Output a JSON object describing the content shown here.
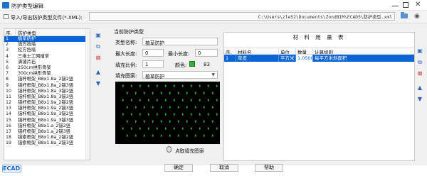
{
  "window": {
    "title": "防护类型编辑"
  },
  "import": {
    "label": "导入/导出防护类型文件(*.XML):",
    "path": "C:\\Users\\zle52\\Documents\\ZondBIM\\ECAD5\\防护类型.xml"
  },
  "type_list": {
    "col_index": "序.",
    "col_type": "防护类型",
    "items": [
      {
        "n": "1",
        "t": "植草防护"
      },
      {
        "n": "2",
        "t": "填方挡墙"
      },
      {
        "n": "3",
        "t": "挖方挡墙"
      },
      {
        "n": "4",
        "t": "三维土工网植草"
      },
      {
        "n": "5",
        "t": "满铺片石"
      },
      {
        "n": "6",
        "t": "250cm拱形骨架"
      },
      {
        "n": "7",
        "t": "300cm拱形骨架"
      },
      {
        "n": "8",
        "t": "锚杆框架_B8x1.8a_2锚2竖"
      },
      {
        "n": "9",
        "t": "锚杆框架_B8x1.8a_2锚3竖"
      },
      {
        "n": "10",
        "t": "锚杆框架_B8x1.8a_3锚2竖"
      },
      {
        "n": "11",
        "t": "锚杆框架_B8x1.8a_3锚3竖"
      },
      {
        "n": "12",
        "t": "锚杆框架_B8x1.9a_2锚2竖"
      },
      {
        "n": "13",
        "t": "锚杆框架_B8x1.9a_2锚3竖"
      },
      {
        "n": "14",
        "t": "锚杆框架_B8x1.9a_3锚2竖"
      },
      {
        "n": "15",
        "t": "锚杆框架_B8x1.9a_3锚3竖"
      },
      {
        "n": "16",
        "t": "锚杆框架_B8x1.a_2锚2竖"
      },
      {
        "n": "17",
        "t": "锚杆框架_B8x1.a_2锚3竖"
      },
      {
        "n": "18",
        "t": "锚索框架_B8x1.8a_2锚2竖"
      },
      {
        "n": "19",
        "t": "锚索框架_B8x1.8a_2锚3竖"
      }
    ]
  },
  "current": {
    "group_label": "当前防护类型",
    "type_name_label": "类型名称:",
    "type_name_value": "植草防护",
    "max_length_label": "最大长度:",
    "max_length_value": "0",
    "min_length_label": "最小长度:",
    "min_length_value": "0",
    "fill_scale_label": "填充比例:",
    "fill_scale_value": "1",
    "color_label": "颜色:",
    "color_value": "83",
    "color_hex": "#34b233",
    "pattern_label": "填充图案:",
    "pattern_value": "植草防护",
    "pick_pattern_label": "点取填充图案"
  },
  "materials": {
    "title": "材 料 用 量 表",
    "headers": [
      "序.",
      "材料名",
      "单位",
      "数量",
      "计算规则"
    ],
    "rows": [
      {
        "n": "1",
        "name": "草皮",
        "unit": "平方米",
        "qty": "1.0500",
        "rule": "每平方米斜面积"
      }
    ]
  },
  "footer": {
    "ok": "确定",
    "cancel": "取消",
    "help": "帮助",
    "logo": "ECAD"
  },
  "colors": {
    "selection": "#0a64d6",
    "accent": "#1e72c8"
  }
}
